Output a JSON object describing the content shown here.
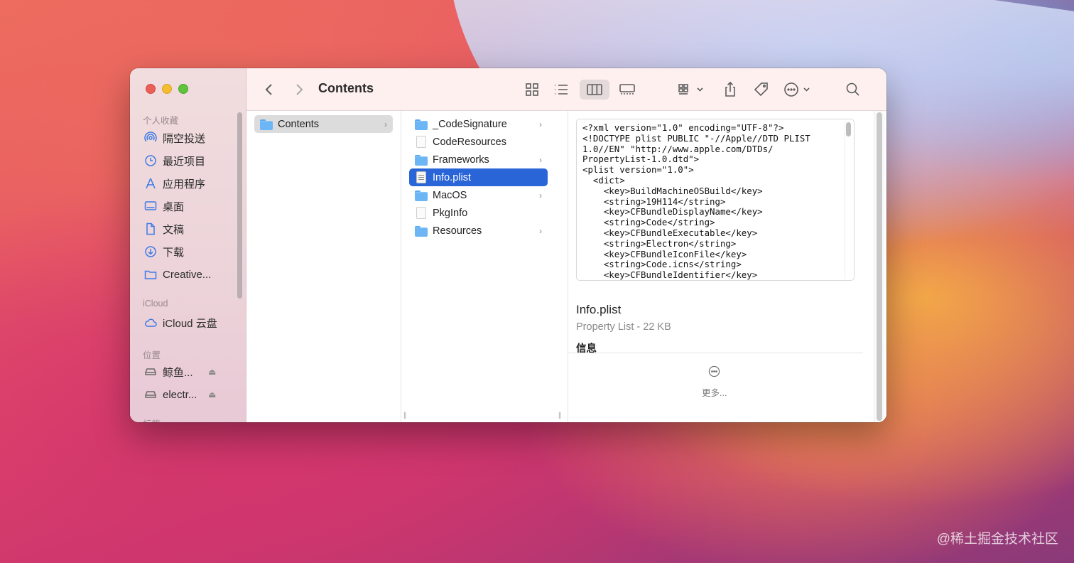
{
  "window": {
    "title": "Contents"
  },
  "sidebar": {
    "favorites_header": "个人收藏",
    "favorites": [
      {
        "label": "隔空投送",
        "icon": "airdrop-icon"
      },
      {
        "label": "最近项目",
        "icon": "clock-icon"
      },
      {
        "label": "应用程序",
        "icon": "applications-icon"
      },
      {
        "label": "桌面",
        "icon": "desktop-icon"
      },
      {
        "label": "文稿",
        "icon": "document-icon"
      },
      {
        "label": "下载",
        "icon": "download-icon"
      },
      {
        "label": "Creative...",
        "icon": "folder-icon"
      }
    ],
    "icloud_header": "iCloud",
    "icloud": [
      {
        "label": "iCloud 云盘",
        "icon": "cloud-icon"
      }
    ],
    "locations_header": "位置",
    "locations": [
      {
        "label": "鲸鱼...",
        "icon": "disk-icon"
      },
      {
        "label": "electr...",
        "icon": "disk-icon"
      }
    ],
    "tags_header": "标签"
  },
  "toolbar": {
    "back": "back-icon",
    "forward": "forward-icon",
    "title": "Contents",
    "views": [
      "icon-view-icon",
      "list-view-icon",
      "column-view-icon",
      "gallery-view-icon"
    ],
    "active_view": "column-view-icon",
    "group": "group-icon",
    "share": "share-icon",
    "tag": "tag-icon",
    "action": "more-actions-icon",
    "search": "search-icon"
  },
  "columns": {
    "col1": [
      {
        "label": "Contents",
        "type": "folder",
        "selected": true
      }
    ],
    "col2": [
      {
        "label": "_CodeSignature",
        "type": "folder"
      },
      {
        "label": "CodeResources",
        "type": "file"
      },
      {
        "label": "Frameworks",
        "type": "folder"
      },
      {
        "label": "Info.plist",
        "type": "plist",
        "selected": true
      },
      {
        "label": "MacOS",
        "type": "folder"
      },
      {
        "label": "PkgInfo",
        "type": "file"
      },
      {
        "label": "Resources",
        "type": "folder"
      }
    ]
  },
  "preview": {
    "code": "<?xml version=\"1.0\" encoding=\"UTF-8\"?>\n<!DOCTYPE plist PUBLIC \"-//Apple//DTD PLIST\n1.0//EN\" \"http://www.apple.com/DTDs/\nPropertyList-1.0.dtd\">\n<plist version=\"1.0\">\n  <dict>\n    <key>BuildMachineOSBuild</key>\n    <string>19H114</string>\n    <key>CFBundleDisplayName</key>\n    <string>Code</string>\n    <key>CFBundleExecutable</key>\n    <string>Electron</string>\n    <key>CFBundleIconFile</key>\n    <string>Code.icns</string>\n    <key>CFBundleIdentifier</key>",
    "file_name": "Info.plist",
    "kind": "Property List - 22 KB",
    "info_header": "信息",
    "more_label": "更多..."
  },
  "watermark": "@稀土掘金技术社区"
}
